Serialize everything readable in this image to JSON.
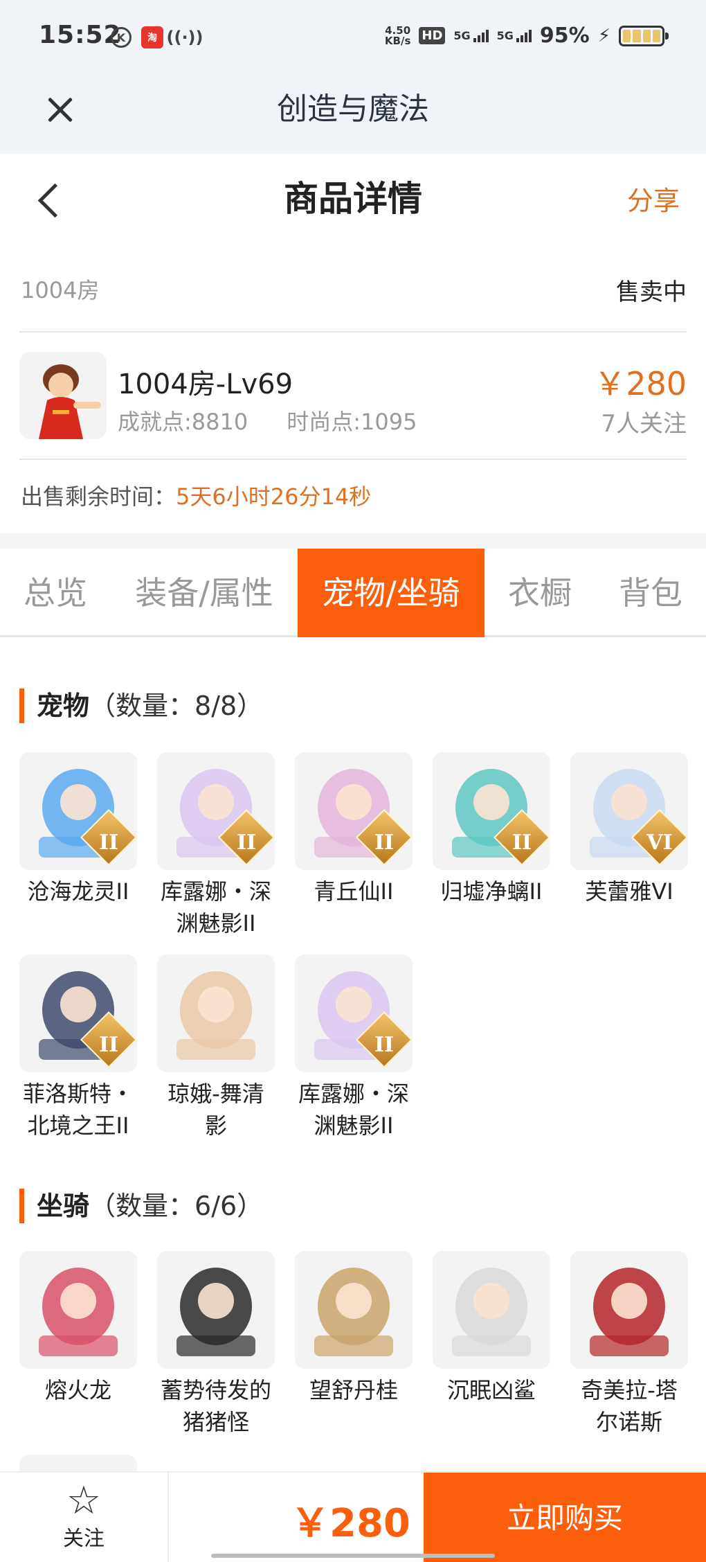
{
  "status_bar": {
    "time": "15:52",
    "net_speed_value": "4.50",
    "net_speed_unit": "KB/s",
    "hd_label": "HD",
    "signal1": "5G",
    "signal2": "5G",
    "battery_percent": "95%"
  },
  "app": {
    "title": "创造与魔法"
  },
  "page": {
    "title": "商品详情",
    "share_label": "分享"
  },
  "room": {
    "id": "1004房",
    "status": "售卖中"
  },
  "item": {
    "name": "1004房-Lv69",
    "achievement": "成就点:8810",
    "fashion": "时尚点:1095",
    "price": "￥280",
    "followers": "7人关注"
  },
  "remaining": {
    "label": "出售剩余时间：",
    "time": "5天6小时26分14秒"
  },
  "tabs": [
    {
      "label": "总览",
      "active": false
    },
    {
      "label": "装备/属性",
      "active": false
    },
    {
      "label": "宠物/坐骑",
      "active": true
    },
    {
      "label": "衣橱",
      "active": false
    },
    {
      "label": "背包",
      "active": false
    }
  ],
  "pets": {
    "title": "宠物",
    "count": "（数量：8/8）",
    "items": [
      {
        "name": "沧海龙灵II",
        "badge": "II",
        "icon": "blue-dragon-spirit",
        "color": "#5aa9f0"
      },
      {
        "name": "库露娜・深渊魅影II",
        "badge": "II",
        "icon": "white-hair-girl",
        "color": "#d9c6ee"
      },
      {
        "name": "青丘仙II",
        "badge": "II",
        "icon": "fox-fairy",
        "color": "#e3b5d9"
      },
      {
        "name": "归墟净螭II",
        "badge": "II",
        "icon": "teal-dragon",
        "color": "#5ec7c2"
      },
      {
        "name": "芙蕾雅VI",
        "badge": "VI",
        "icon": "winged-goddess",
        "color": "#c8d9f0"
      },
      {
        "name": "菲洛斯特・北境之王II",
        "badge": "II",
        "icon": "dark-wolf-king",
        "color": "#3f4a6b"
      },
      {
        "name": "琼娥-舞清影",
        "badge": "",
        "icon": "dancer-girl",
        "color": "#e8c8a8"
      },
      {
        "name": "库露娜・深渊魅影II",
        "badge": "II",
        "icon": "white-hair-girl",
        "color": "#d9c6ee"
      }
    ]
  },
  "mounts": {
    "title": "坐骑",
    "count": "（数量：6/6）",
    "items": [
      {
        "name": "熔火龙",
        "icon": "red-dragon-head",
        "color": "#d8506a"
      },
      {
        "name": "蓄势待发的猪猪怪",
        "icon": "black-pig",
        "color": "#2a2a2a"
      },
      {
        "name": "望舒丹桂",
        "icon": "swing-chair",
        "color": "#c9a36a"
      },
      {
        "name": "沉眠凶鲨",
        "icon": "white-shark",
        "color": "#d8d8d8"
      },
      {
        "name": "奇美拉-塔尔诺斯",
        "icon": "chimera-beast",
        "color": "#b3262c"
      }
    ]
  },
  "bottom": {
    "follow_label": "关注",
    "price": "￥280",
    "buy_label": "立即购买"
  }
}
